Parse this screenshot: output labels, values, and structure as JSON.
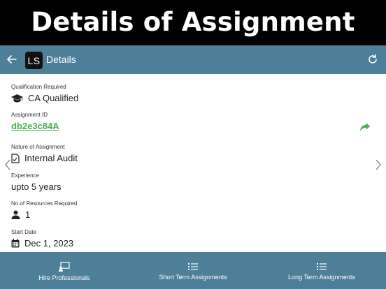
{
  "banner": {
    "title": "Details of Assignment"
  },
  "appbar": {
    "logo_text": "LS",
    "title": "Details"
  },
  "fields": {
    "qualification": {
      "label": "Qualification Required",
      "value": "CA Qualified",
      "icon": "graduation-cap-icon"
    },
    "assignment_id": {
      "label": "Assignment ID",
      "value": "db2e3c84A",
      "action_icon": "share-icon"
    },
    "nature": {
      "label": "Nature of Assignment",
      "value": "Internal Audit",
      "icon": "document-icon"
    },
    "experience": {
      "label": "Experience",
      "value": "upto 5 years"
    },
    "resources": {
      "label": "No.of Resources Required",
      "value": "1",
      "icon": "user-icon"
    },
    "start_date": {
      "label": "Start Date",
      "value": "Dec 1, 2023",
      "icon": "calendar-icon"
    }
  },
  "bottom_tabs": [
    {
      "label": "Hire Professionals",
      "icon": "hire-professionals-icon"
    },
    {
      "label": "Short Term Assignments",
      "icon": "list-icon"
    },
    {
      "label": "Long Term Assignments",
      "icon": "list-icon"
    }
  ],
  "colors": {
    "primary": "#4e7f98",
    "link": "#4caf50",
    "banner_bg": "#000000"
  }
}
